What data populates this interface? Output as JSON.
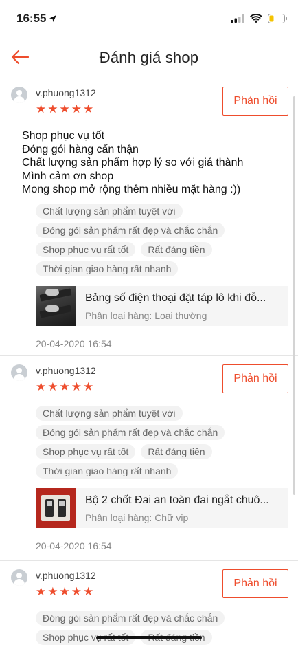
{
  "status_bar": {
    "time": "16:55",
    "icons": [
      "location-arrow-icon",
      "signal-icon",
      "wifi-icon",
      "battery-icon"
    ]
  },
  "header": {
    "title": "Đánh giá shop",
    "back_icon": "arrow-left-icon"
  },
  "colors": {
    "accent": "#ee4d2d",
    "tag_bg": "#f2f2f2",
    "product_bg": "#f5f5f5"
  },
  "reviews": [
    {
      "username": "v.phuong1312",
      "rating": 5,
      "reply_label": "Phản hồi",
      "text_lines": [
        "Shop phục vụ tốt",
        "Đóng gói hàng cẩn thận",
        "Chất lượng sản phẩm hợp lý so với giá thành",
        "Mình cảm ơn shop",
        "Mong shop mở rộng thêm nhiều mặt hàng :))"
      ],
      "tags": [
        "Chất lượng sản phẩm tuyệt vời",
        "Đóng gói sản phẩm rất đẹp và chắc chắn",
        "Shop phục vụ rất tốt",
        "Rất đáng tiền",
        "Thời gian giao hàng rất nhanh"
      ],
      "product": {
        "name": "Bảng số điện thoại đặt táp lô khi đỗ...",
        "variant": "Phân loại hàng: Loại thường"
      },
      "timestamp": "20-04-2020 16:54"
    },
    {
      "username": "v.phuong1312",
      "rating": 5,
      "reply_label": "Phản hồi",
      "text_lines": [],
      "tags": [
        "Chất lượng sản phẩm tuyệt vời",
        "Đóng gói sản phẩm rất đẹp và chắc chắn",
        "Shop phục vụ rất tốt",
        "Rất đáng tiền",
        "Thời gian giao hàng rất nhanh"
      ],
      "product": {
        "name": "Bộ 2 chốt Đai an toàn đai ngắt chuô...",
        "variant": "Phân loại hàng: Chữ vip"
      },
      "timestamp": "20-04-2020 16:54"
    },
    {
      "username": "v.phuong1312",
      "rating": 5,
      "reply_label": "Phản hồi",
      "text_lines": [],
      "tags": [
        "Đóng gói sản phẩm rất đẹp và chắc chắn",
        "Shop phục vụ rất tốt",
        "Rất đáng tiền"
      ]
    }
  ]
}
